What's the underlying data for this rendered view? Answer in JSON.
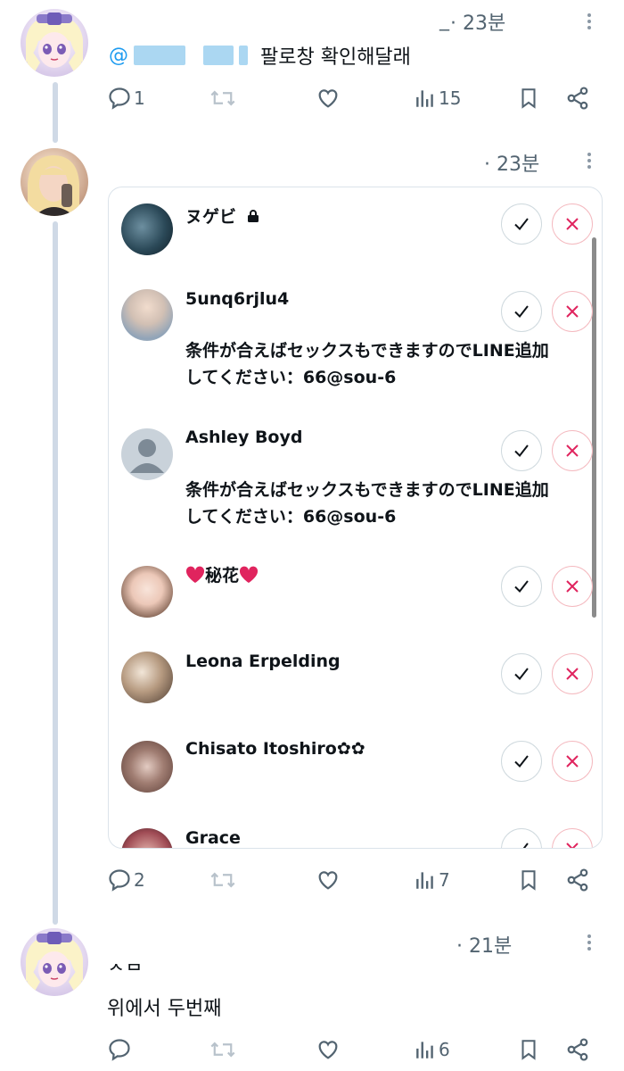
{
  "posts": [
    {
      "time": "· 23분",
      "name_fragment": "_",
      "mention_at": "@",
      "text": "팔로창 확인해달래",
      "stats": {
        "reply": "1",
        "retweet": "",
        "like": "",
        "views": "15"
      }
    },
    {
      "time": "· 23분",
      "stats": {
        "reply": "2",
        "retweet": "",
        "like": "",
        "views": "7"
      },
      "follow_requests": [
        {
          "name": "ヌゲビ",
          "bio_line1": "",
          "bio_line2": ""
        },
        {
          "name": "5unq6rjlu4",
          "bio_line1": "条件が合えばセックスもできますのでLINE追加",
          "bio_line2": "してください：66@sou-6"
        },
        {
          "name": "Ashley Boyd",
          "bio_line1": "条件が合えばセックスもできますのでLINE追加",
          "bio_line2": "してください：66@sou-6"
        },
        {
          "name": "秘花",
          "bio_line1": "",
          "bio_line2": ""
        },
        {
          "name": "Leona Erpelding",
          "bio_line1": "",
          "bio_line2": ""
        },
        {
          "name": "Chisato Itoshiro✿✿",
          "bio_line1": "",
          "bio_line2": ""
        },
        {
          "name": "Grace",
          "bio_line1": "",
          "bio_line2": ""
        }
      ]
    },
    {
      "time": "· 21분",
      "text_partial": "ㅈㅂ",
      "text": "위에서 두번째",
      "stats": {
        "reply": "",
        "retweet": "",
        "like": "",
        "views": "6"
      }
    }
  ],
  "icons": [
    "more-icon",
    "reply-icon",
    "retweet-icon",
    "like-icon",
    "views-icon",
    "bookmark-icon",
    "share-icon",
    "lock-icon",
    "check-icon",
    "close-icon",
    "heart-emoji-icon",
    "flower-icon"
  ],
  "colors": {
    "accent": "#1d9bf0",
    "text": "#0f1419",
    "muted": "#536471",
    "reject": "#e0245e",
    "thread": "#cfd9e6"
  }
}
